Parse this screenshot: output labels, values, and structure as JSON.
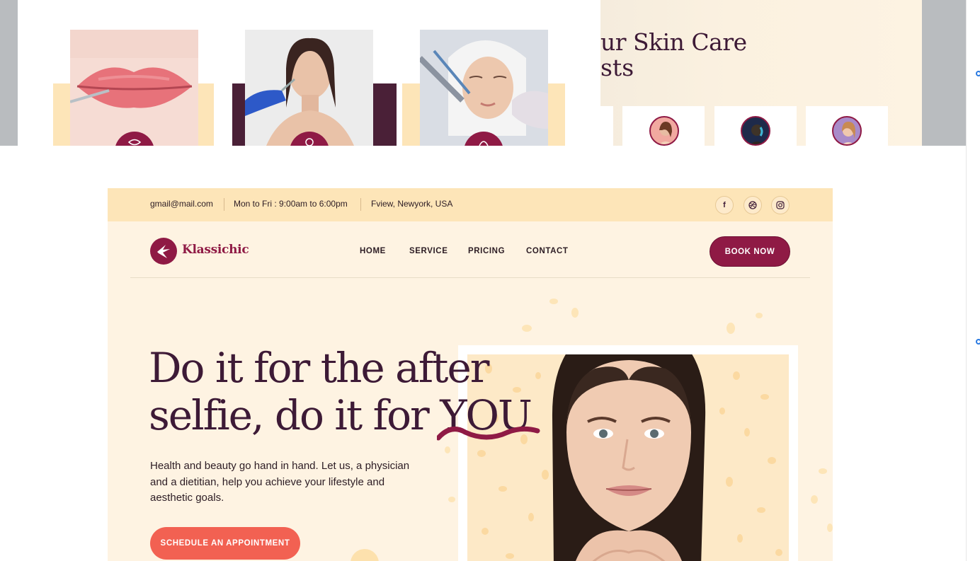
{
  "preview": {
    "title_line1": "ur Skin Care",
    "title_line2": "sts"
  },
  "topbar": {
    "email": "gmail@mail.com",
    "hours": "Mon to Fri : 9:00am to 6:00pm",
    "location": "Fview, Newyork, USA",
    "social": [
      "f",
      "dribbble",
      "instagram"
    ]
  },
  "brand": {
    "name": "Klassichic"
  },
  "nav": {
    "items": [
      "HOME",
      "SERVICE",
      "PRICING",
      "CONTACT"
    ],
    "book_label": "BOOK NOW"
  },
  "hero": {
    "line1": "Do it for the after",
    "line2_a": "selfie, do it for ",
    "line2_b": "YOU",
    "description": "Health and beauty go hand in hand. Let us, a physician and a dietitian, help you achieve your lifestyle and aesthetic goals.",
    "cta_label": "SCHEDULE AN APPOINTMENT"
  },
  "colors": {
    "brand": "#8f1a45",
    "accent": "#f26152",
    "cream": "#fef3e2",
    "topbar": "#fde5b8",
    "heading": "#3d1a36"
  }
}
